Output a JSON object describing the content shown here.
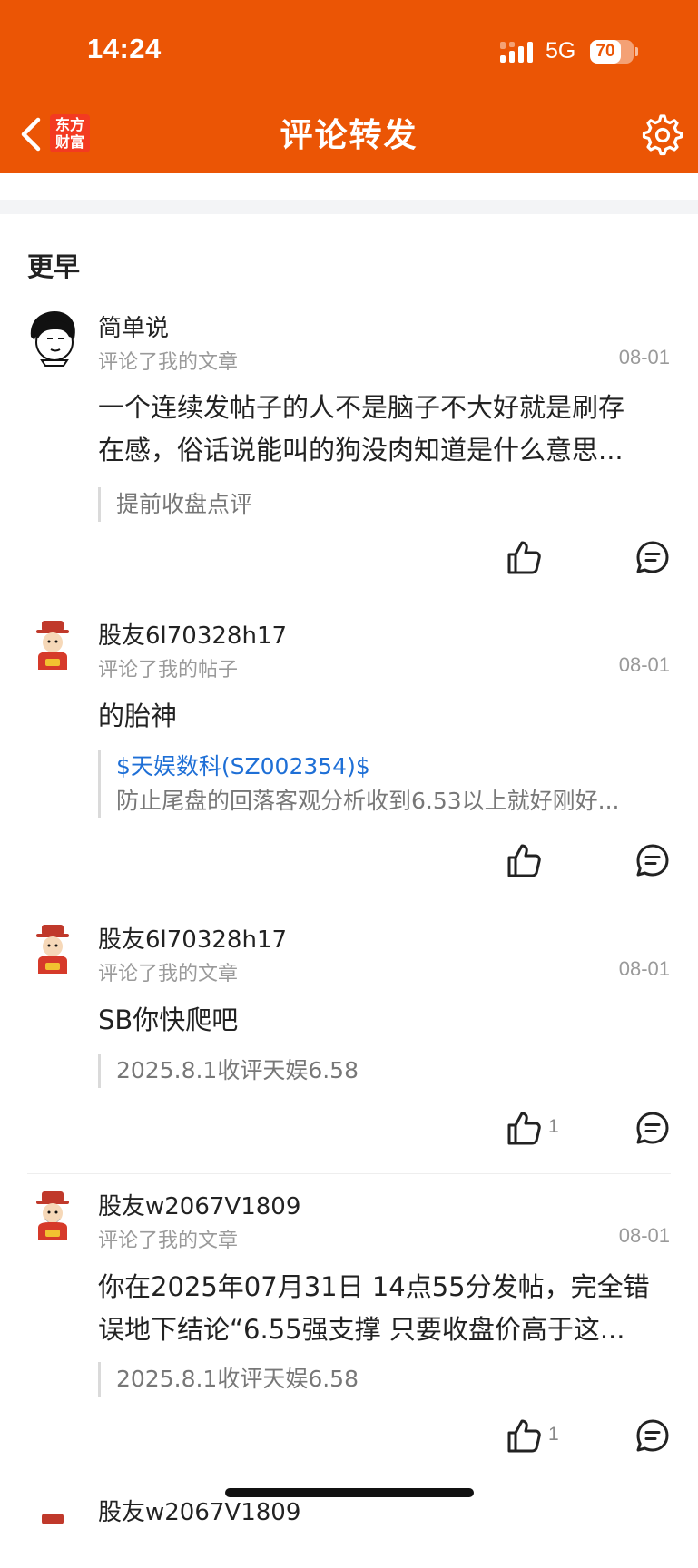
{
  "status_bar": {
    "time": "14:24",
    "network": "5G",
    "battery": "70",
    "battery_level": 0.7
  },
  "header": {
    "title": "评论转发",
    "logo_line1": "东方",
    "logo_line2": "财富",
    "accent_color": "#eb5505"
  },
  "section_title": "更早",
  "comments": [
    {
      "username": "简单说",
      "action": "评论了我的文章",
      "date": "08-01",
      "content": [
        "一个连续发帖子的人不是脑子不大好就是刷存",
        "在感，俗话说能叫的狗没肉知道是什么意思..."
      ],
      "quote_link": "",
      "quote_text": "提前收盘点评",
      "likes": ""
    },
    {
      "username": "股友6l70328h17",
      "action": "评论了我的帖子",
      "date": "08-01",
      "content": [
        "的胎神"
      ],
      "quote_link": "$天娱数科(SZ002354)$",
      "quote_text": "防止尾盘的回落客观分析收到6.53以上就好刚好...",
      "likes": ""
    },
    {
      "username": "股友6l70328h17",
      "action": "评论了我的文章",
      "date": "08-01",
      "content": [
        "SB你快爬吧"
      ],
      "quote_link": "",
      "quote_text": "2025.8.1收评天娱6.58",
      "likes": "1"
    },
    {
      "username": "股友w2067V1809",
      "action": "评论了我的文章",
      "date": "08-01",
      "content": [
        "你在2025年07月31日 14点55分发帖，完全错",
        "误地下结论“6.55强支撑 只要收盘价高于这..."
      ],
      "quote_link": "",
      "quote_text": "2025.8.1收评天娱6.58",
      "likes": "1"
    },
    {
      "username": "股友w2067V1809"
    }
  ]
}
